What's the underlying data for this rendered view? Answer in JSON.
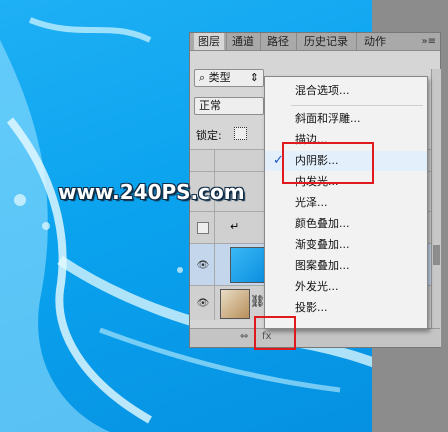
{
  "panel": {
    "tabs": [
      "图层",
      "通道",
      "路径",
      "历史记录",
      "动作"
    ],
    "menu_icon": "»≡",
    "kind_filter": "类型",
    "blend_mode": "正常",
    "lock_label": "锁定:"
  },
  "style_menu": {
    "items": [
      {
        "label": "混合选项...",
        "checked": false
      },
      {
        "label": "斜面和浮雕...",
        "checked": false
      },
      {
        "label": "描边...",
        "checked": false
      },
      {
        "label": "内阴影...",
        "checked": true
      },
      {
        "label": "内发光...",
        "checked": false
      },
      {
        "label": "光泽...",
        "checked": false
      },
      {
        "label": "颜色叠加...",
        "checked": false
      },
      {
        "label": "渐变叠加...",
        "checked": false
      },
      {
        "label": "图案叠加...",
        "checked": false
      },
      {
        "label": "外发光...",
        "checked": false
      },
      {
        "label": "投影...",
        "checked": false
      }
    ],
    "check_mark": "✓"
  },
  "watermark": "www.240PS.com",
  "colors": {
    "highlight": "#e0191f",
    "background": "#0aa2ee"
  }
}
